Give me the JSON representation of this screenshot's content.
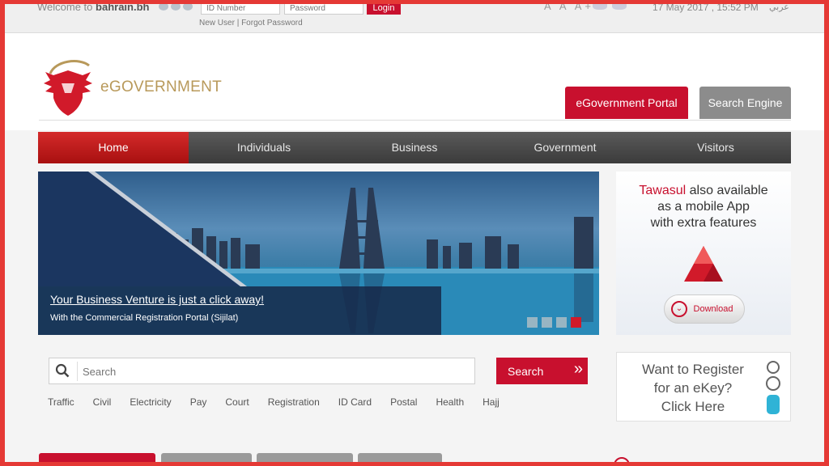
{
  "topbar": {
    "welcome_text": "Welcome to",
    "welcome_site": "bahrain.bh",
    "id_placeholder": "ID Number",
    "password_placeholder": "Password",
    "login_label": "Login",
    "new_user": "New User",
    "separator": "|",
    "forgot_password": "Forgot Password",
    "font_controls": "A A A+",
    "datetime": "17 May 2017 , 15:52 PM",
    "language": "عربي"
  },
  "header": {
    "brand": "eGOVERNMENT",
    "portal_button": "eGovernment Portal",
    "engine_button": "Search Engine"
  },
  "nav": {
    "items": [
      "Home",
      "Individuals",
      "Business",
      "Government",
      "Visitors"
    ],
    "active": "Home"
  },
  "banner": {
    "title": "Your Business Venture is just a click away!",
    "subtitle": "With the Commercial Registration Portal (Sijilat)",
    "slides": 4,
    "active_slide": 4
  },
  "tawasul": {
    "name": "Tawasul",
    "line1_rest": "also available",
    "line2": "as a mobile App",
    "line3": "with extra features",
    "download_label": "Download"
  },
  "search": {
    "placeholder": "Search",
    "button_label": "Search",
    "quick_links": [
      "Traffic",
      "Civil",
      "Electricity",
      "Pay",
      "Court",
      "Registration",
      "ID Card",
      "Postal",
      "Health",
      "Hajj"
    ]
  },
  "ekey": {
    "line1": "Want to Register",
    "line2": "for an eKey?",
    "line3": "Click Here"
  },
  "colors": {
    "accent": "#c8102e",
    "nav_dark": "#3b3b3b",
    "brand_gold": "#b8995a",
    "frame": "#e53935"
  }
}
